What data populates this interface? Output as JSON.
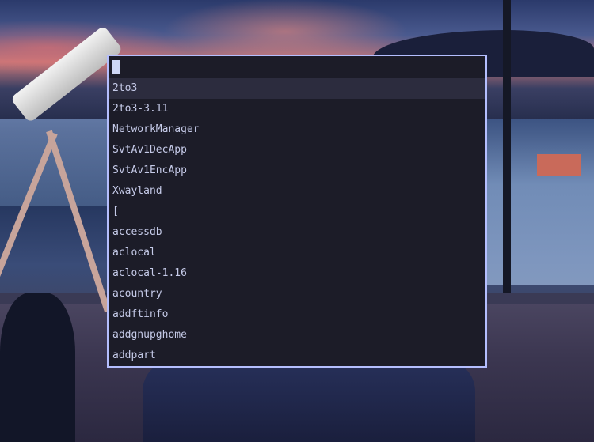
{
  "launcher": {
    "query": "",
    "selected_index": 0,
    "items": [
      "2to3",
      "2to3-3.11",
      "NetworkManager",
      "SvtAv1DecApp",
      "SvtAv1EncApp",
      "Xwayland",
      "[",
      "accessdb",
      "aclocal",
      "aclocal-1.16",
      "acountry",
      "addftinfo",
      "addgnupghome",
      "addpart"
    ]
  },
  "colors": {
    "launcher_bg": "#1c1c28",
    "launcher_border": "#b4befe",
    "selected_bg": "#2c2c3e",
    "text": "#c5cae8",
    "cursor": "#cdd6f4"
  }
}
